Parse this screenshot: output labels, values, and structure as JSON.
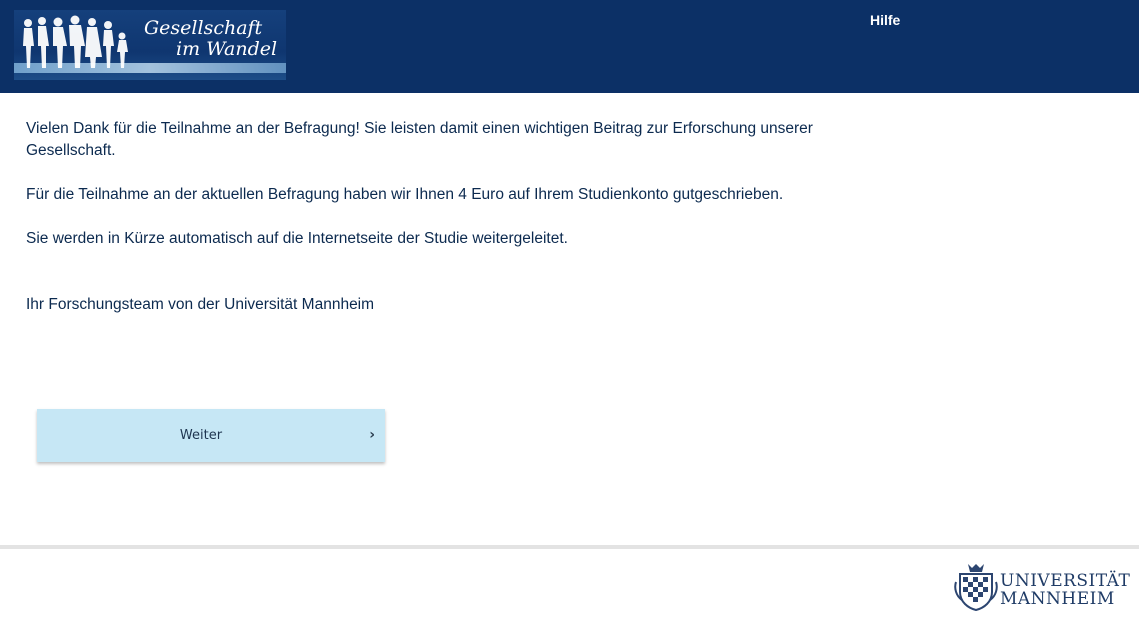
{
  "header": {
    "logo_line1": "Gesellschaft",
    "logo_line2": "im Wandel",
    "help_label": "Hilfe"
  },
  "content": {
    "paragraph1": "Vielen Dank für die Teilnahme an der Befragung! Sie leisten damit einen wichtigen Beitrag zur Erforschung unserer Gesellschaft.",
    "paragraph2": "Für die Teilnahme an der aktuellen Befragung haben wir Ihnen 4 Euro auf Ihrem Studienkonto gutgeschrieben.",
    "paragraph3": "Sie werden in Kürze automatisch auf die Internetseite der Studie weitergeleitet.",
    "signature": "Ihr Forschungsteam von der Universität Mannheim"
  },
  "navigation": {
    "next_label": "Weiter",
    "next_icon": "chevron-right-icon"
  },
  "footer": {
    "uni_line1": "UNIVERSITÄT",
    "uni_line2": "MANNHEIM"
  },
  "colors": {
    "header_bg": "#0c3066",
    "button_bg": "#c6e7f5",
    "text": "#0c2a4f"
  }
}
